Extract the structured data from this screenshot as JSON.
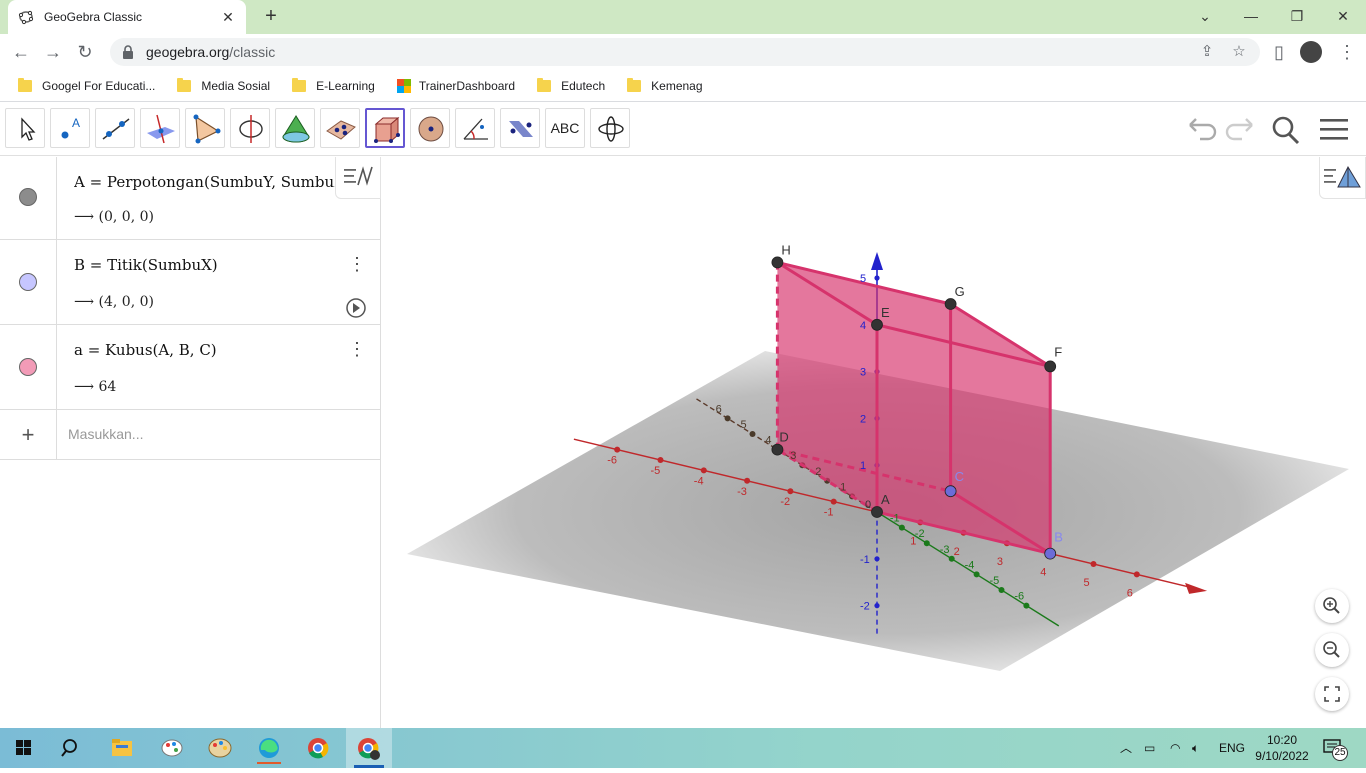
{
  "browser": {
    "tab_title": "GeoGebra Classic",
    "url_domain": "geogebra.org",
    "url_path": "/classic",
    "bookmarks": [
      {
        "label": "Googel For Educati...",
        "icon": "folder-icon"
      },
      {
        "label": "Media Sosial",
        "icon": "folder-icon"
      },
      {
        "label": "E-Learning",
        "icon": "folder-icon"
      },
      {
        "label": "TrainerDashboard",
        "icon": "microsoft-icon"
      },
      {
        "label": "Edutech",
        "icon": "folder-icon"
      },
      {
        "label": "Kemenag",
        "icon": "folder-icon"
      }
    ]
  },
  "ggb_toolbar": {
    "tools": [
      "move-tool-icon",
      "point-tool-icon",
      "line-tool-icon",
      "perpendicular-tool-icon",
      "polygon-tool-icon",
      "circle-axis-tool-icon",
      "cone-tool-icon",
      "plane-tool-icon",
      "cube-tool-icon",
      "sphere-tool-icon",
      "angle-tool-icon",
      "reflect-tool-icon",
      "text-tool-icon",
      "rotate-view-tool-icon"
    ],
    "selected_tool": "cube-tool-icon",
    "text_tool_label": "ABC"
  },
  "algebra": {
    "items": [
      {
        "definition": "A  =  Perpotongan(SumbuY, SumbuZ",
        "value": "⟶  (0,  0,  0)",
        "color": "#8c8c8c"
      },
      {
        "definition": "B  =  Titik(SumbuX)",
        "value": "⟶  (4,  0,  0)",
        "color": "#c6c6ff"
      },
      {
        "definition": "a  =  Kubus(A, B, C)",
        "value": "⟶  64",
        "color": "#f29bb7"
      }
    ],
    "input_placeholder": "Masukkan..."
  },
  "graphics": {
    "point_labels": [
      "A",
      "B",
      "C",
      "D",
      "E",
      "F",
      "G",
      "H"
    ],
    "x_ticks": [
      "-6",
      "-5",
      "-4",
      "-3",
      "-2",
      "-1",
      "0",
      "1",
      "2",
      "3",
      "4",
      "5",
      "6"
    ],
    "y_ticks": [
      "-6",
      "-5",
      "-4",
      "-3",
      "-2",
      "-1",
      "1",
      "2",
      "3",
      "4",
      "5",
      "6"
    ],
    "z_ticks": [
      "-2",
      "-1",
      "1",
      "2",
      "3",
      "4",
      "5"
    ],
    "zero_label": "0",
    "colors": {
      "cube": "#d6336c",
      "x_axis": "#c0282b",
      "y_axis": "#1b7a1b",
      "z_axis": "#2222cc"
    }
  },
  "taskbar": {
    "lang": "ENG",
    "time": "10:20",
    "date": "9/10/2022",
    "notifications": "25"
  }
}
